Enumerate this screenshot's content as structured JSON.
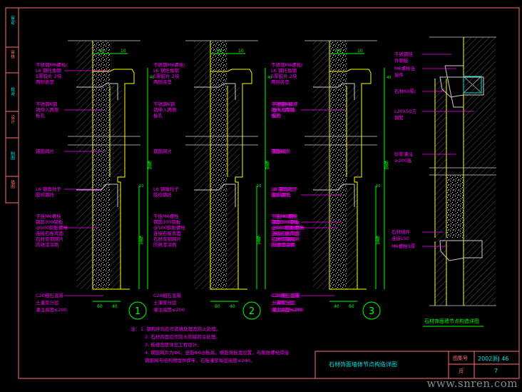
{
  "colors": {
    "frame": "#ff7070",
    "stone": "#ffff00",
    "dims": "#00ff00",
    "labels": "#ff00ff",
    "wall": "#9a9a9a",
    "accent": "#00e5e5"
  },
  "side_strip": [
    "审定",
    "审核",
    "校对",
    "设计",
    "制图",
    "描图"
  ],
  "details": [
    {
      "number": "1",
      "dims_top": [
        "60",
        "10"
      ],
      "dims_right": [
        "40",
        "10",
        "板高",
        "板宽"
      ],
      "dims_bottom": [
        "60",
        "40"
      ],
      "labels_left": [
        "不锈钢M6螺栓/",
        "L6 钢托角钢",
        "5厚胶片 2块",
        "两侧各垫",
        "不锈钢6钢",
        "销伸入两侧",
        "板孔",
        "钢筋网片",
        "L6 钢角托子",
        "胶结钢托",
        "干挂M6螺栓",
        "钢筋300钢板",
        "@500膨胀螺栓",
        "连接石板背面",
        "石材背钢网片",
        "防锈漆涂刷",
        "C20细石混凝",
        "土灌浆分层",
        "灌注高度≤200"
      ],
      "labels_right": [
        "不锈钢M6螺栓/",
        "L6 钢托角钢",
        "5厚胶片 2块",
        "两侧各垫",
        "不锈钢6钢",
        "销伸入两侧",
        "板孔",
        "钢筋网片",
        "L6 钢角托子",
        "胶结钢托",
        "干挂M6螺栓",
        "钢筋300钢板",
        "@500膨胀螺栓",
        "连接石板背面",
        "石材背钢网片",
        "防锈漆涂刷",
        "C20细石混凝",
        "土灌浆分层",
        "灌注高度≤200"
      ]
    },
    {
      "number": "2",
      "dims_top": [
        "60",
        "10"
      ],
      "dims_right": [
        "40",
        "10",
        "板高",
        "板宽"
      ],
      "dims_bottom": [
        "60",
        "40"
      ],
      "labels_right": [
        "不锈钢M6螺栓/",
        "L6 钢托角钢",
        "5厚胶片 2块",
        "两侧各垫",
        "不锈钢6钢",
        "销伸入两侧",
        "板孔",
        "钢筋网片",
        "L6 钢角托子",
        "胶结钢托",
        "干挂M6螺栓",
        "钢筋300钢板",
        "@500膨胀螺栓",
        "连接石板背面",
        "石材背钢网片",
        "防锈漆涂刷",
        "C20细石混凝",
        "土灌浆分层",
        "灌注高度≤200"
      ]
    },
    {
      "number": "3",
      "dims_top": [
        "40",
        "10"
      ],
      "dims_right": [
        "40",
        "10",
        "板高",
        "板宽"
      ],
      "dims_bottom": [
        "40",
        "60"
      ],
      "labels_left": [
        "不锈钢M6螺",
        "栓与角钢连",
        "接件",
        "钢筋网片",
        "L6 钢角托子",
        "胶结钢托",
        "干挂M6螺栓",
        "钢筋300钢板",
        "@500膨胀螺栓",
        "连接石板背面",
        "石材背钢网片",
        "防锈漆涂刷",
        "C20细石混凝",
        "土灌浆分层",
        "灌注高度≤200"
      ]
    }
  ],
  "side_detail": {
    "labels": [
      "不锈钢挂",
      "件钢板",
      "M6螺栓连",
      "接件",
      "石材60厚/",
      "L20X50方",
      "钢管",
      "砂浆灌注",
      "≥200高",
      "石材挂件",
      "连接L50",
      "M6螺栓5厚"
    ],
    "caption": "石材饰面墙节点构造详图"
  },
  "notes": {
    "prefix": "注：",
    "items": [
      "1. 钢构件均应作防锈处理及防火处理。",
      "2. 石材背面应作防水防碱背涂处理。",
      "3. 板缝宽度详见工程设计。",
      "4. 钢筋网片为Φ6，竖筋Φ6@板高，横筋按板宽设置，与膨胀螺栓焊接",
      "   钢筋网与结构预埋件焊牢，石板灌浆每层高度≤240。"
    ]
  },
  "title_block": {
    "title": "石材饰面墙体节点构造详图",
    "atlas_label": "图集号",
    "atlas_value": "2002浙J  46",
    "page_label": "页",
    "page_value": "7"
  },
  "watermark": "www.snren.com"
}
